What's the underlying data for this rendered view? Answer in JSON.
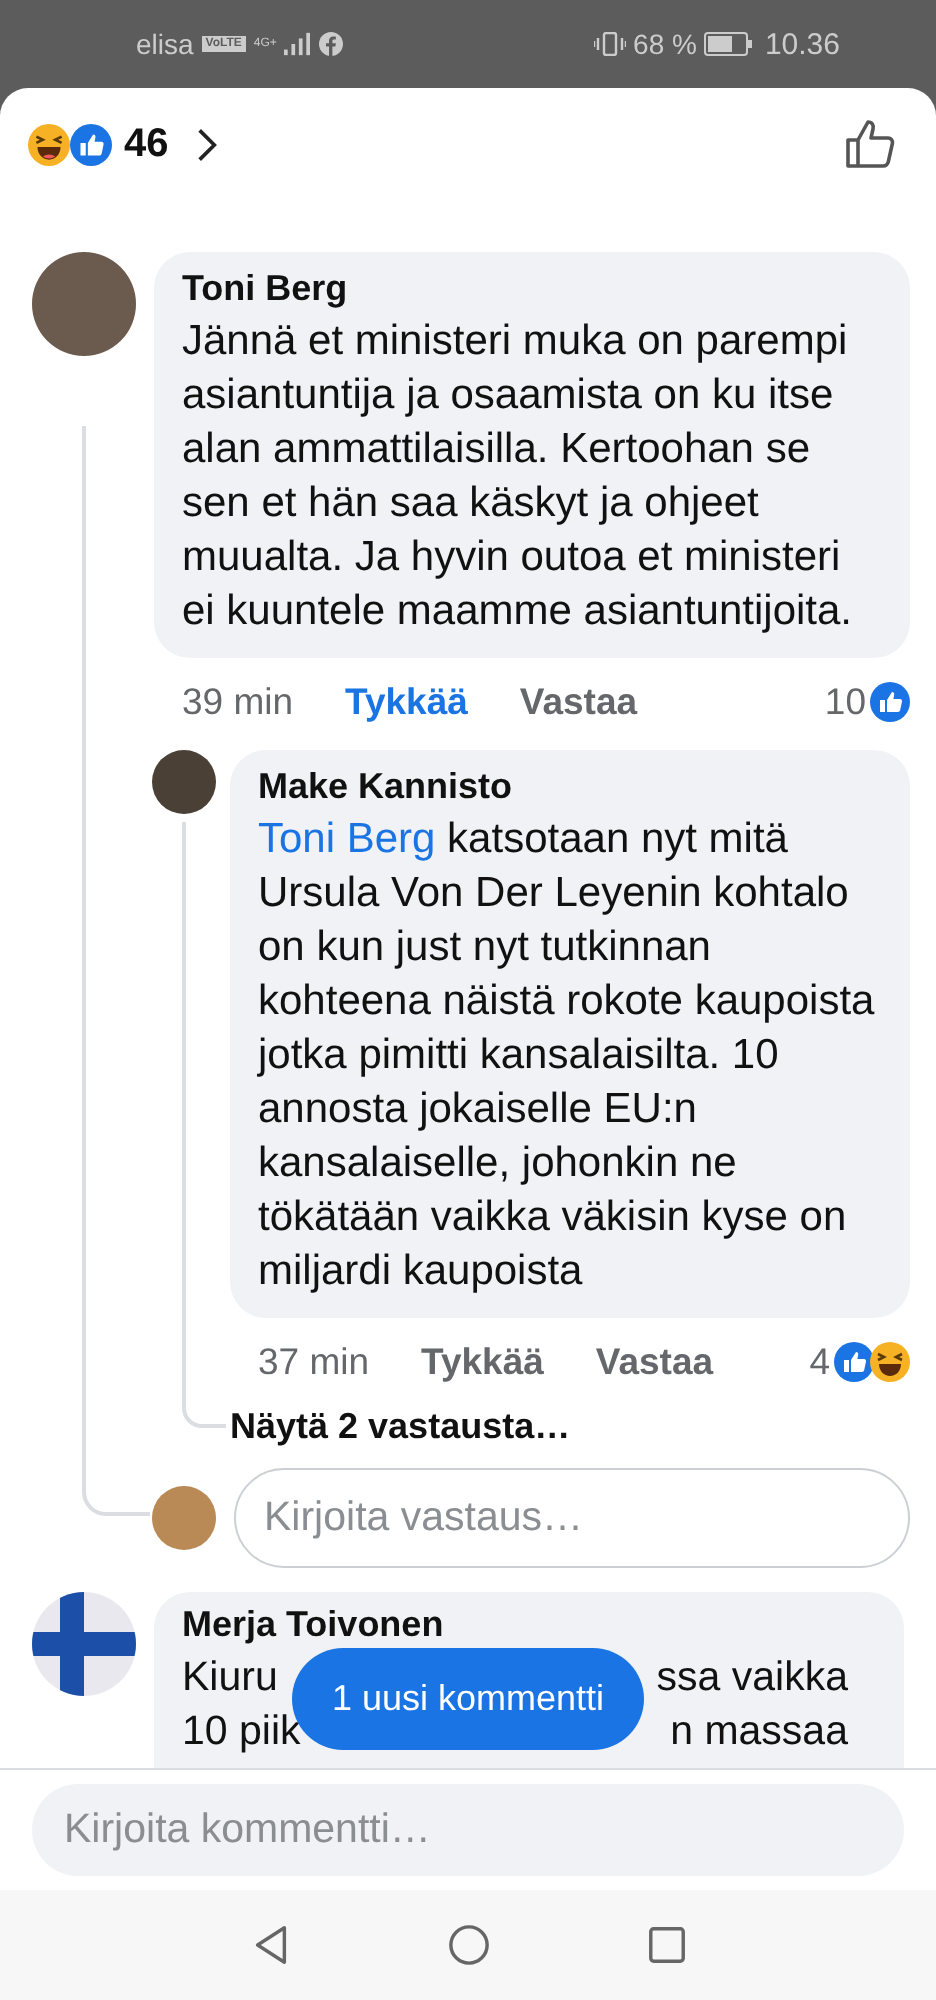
{
  "status_bar": {
    "carrier": "elisa",
    "volte": "VoLTE",
    "network": "4G+",
    "battery": "68 %",
    "time": "10.36"
  },
  "header": {
    "reactions": [
      {
        "kind": "haha"
      },
      {
        "kind": "like"
      }
    ],
    "reaction_count": "46"
  },
  "comments": [
    {
      "author": "Toni Berg",
      "text": "Jännä et ministeri muka on parempi asiantuntija ja osaamista on ku itse alan ammattilaisilla. Kertoohan se sen et hän saa käskyt ja ohjeet muualta. Ja hyvin outoa et ministeri ei kuuntele maamme asiantuntijoita.",
      "time": "39 min",
      "like_label": "Tykkää",
      "liked": true,
      "reply_label": "Vastaa",
      "reaction_count": "10",
      "reactions": [
        {
          "kind": "like"
        }
      ],
      "replies": [
        {
          "author": "Make Kannisto",
          "mention": "Toni Berg",
          "text": " katsotaan nyt mitä Ursula Von Der Leyenin kohtalo on kun just nyt tutkinnan kohteena näistä rokote kaupoista jotka pimitti kansalaisilta. 10 annosta jokaiselle EU:n kansalaiselle, johonkin ne tökätään vaikka väkisin kyse on miljardi kaupoista",
          "time": "37 min",
          "like_label": "Tykkää",
          "liked": false,
          "reply_label": "Vastaa",
          "reaction_count": "4",
          "reactions": [
            {
              "kind": "like"
            },
            {
              "kind": "haha"
            }
          ]
        }
      ],
      "more_replies": "Näytä 2 vastausta…",
      "reply_placeholder": "Kirjoita vastaus…"
    },
    {
      "author": "Merja Toivonen",
      "fragments": [
        [
          "Kiuru",
          "ssa vaikka"
        ],
        [
          "10 piik",
          "n massaa"
        ]
      ]
    }
  ],
  "new_comment_toast": "1 uusi kommentti",
  "comment_box": {
    "placeholder": "Kirjoita kommentti…"
  }
}
